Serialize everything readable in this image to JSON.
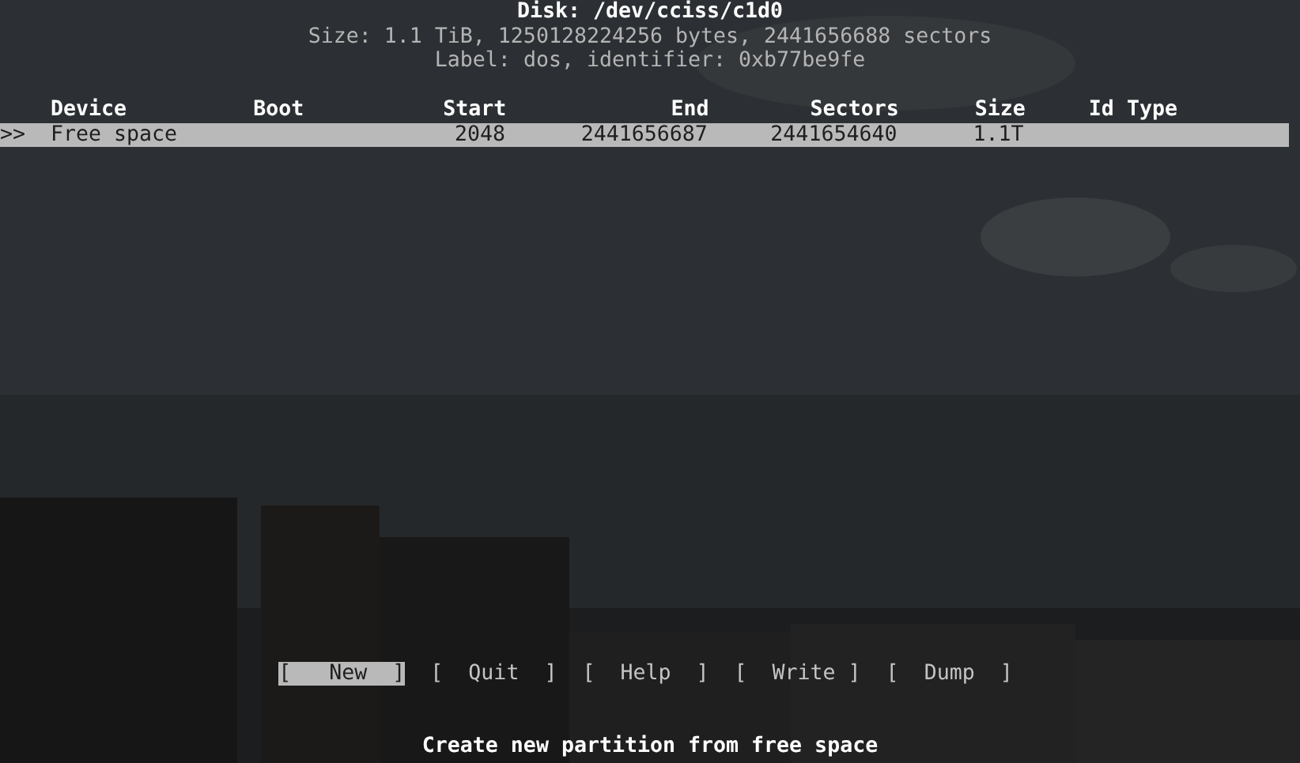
{
  "header": {
    "title": "Disk: /dev/cciss/c1d0",
    "size_line": "Size: 1.1 TiB, 1250128224256 bytes, 2441656688 sectors",
    "label_line": "Label: dos, identifier: 0xb77be9fe"
  },
  "table": {
    "columns": [
      "Device",
      "Boot",
      "Start",
      "End",
      "Sectors",
      "Size",
      "Id Type"
    ],
    "rows": [
      {
        "marker": ">>",
        "selected": true,
        "cells": [
          "Free space",
          "",
          "2048",
          "2441656687",
          "2441654640",
          "1.1T",
          ""
        ]
      }
    ]
  },
  "buttons": [
    {
      "label": "[   New  ]",
      "selected": true
    },
    {
      "label": "[  Quit  ]",
      "selected": false
    },
    {
      "label": "[  Help  ]",
      "selected": false
    },
    {
      "label": "[  Write ]",
      "selected": false
    },
    {
      "label": "[  Dump  ]",
      "selected": false
    }
  ],
  "hint": "Create new partition from free space"
}
